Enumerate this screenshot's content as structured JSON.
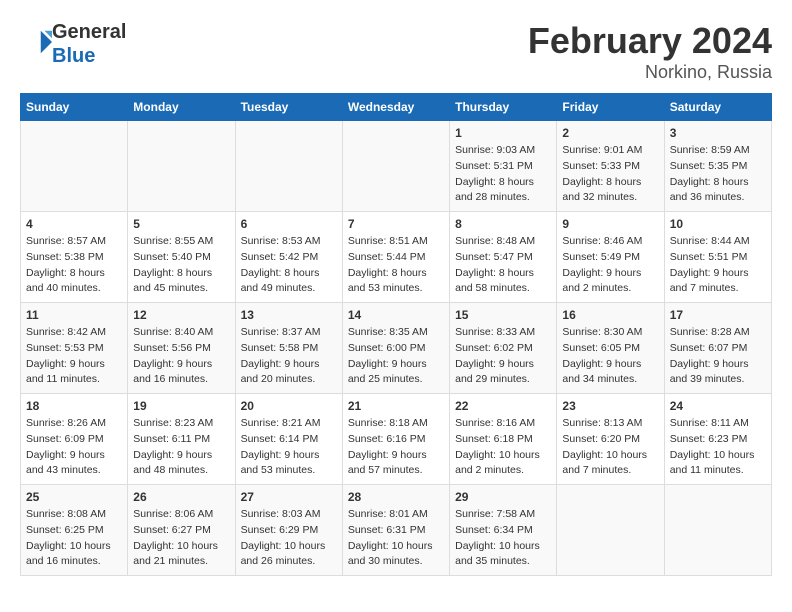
{
  "header": {
    "logo_line1": "General",
    "logo_line2": "Blue",
    "title": "February 2024",
    "subtitle": "Norkino, Russia"
  },
  "weekdays": [
    "Sunday",
    "Monday",
    "Tuesday",
    "Wednesday",
    "Thursday",
    "Friday",
    "Saturday"
  ],
  "weeks": [
    [
      {
        "day": "",
        "info": ""
      },
      {
        "day": "",
        "info": ""
      },
      {
        "day": "",
        "info": ""
      },
      {
        "day": "",
        "info": ""
      },
      {
        "day": "1",
        "info": "Sunrise: 9:03 AM\nSunset: 5:31 PM\nDaylight: 8 hours\nand 28 minutes."
      },
      {
        "day": "2",
        "info": "Sunrise: 9:01 AM\nSunset: 5:33 PM\nDaylight: 8 hours\nand 32 minutes."
      },
      {
        "day": "3",
        "info": "Sunrise: 8:59 AM\nSunset: 5:35 PM\nDaylight: 8 hours\nand 36 minutes."
      }
    ],
    [
      {
        "day": "4",
        "info": "Sunrise: 8:57 AM\nSunset: 5:38 PM\nDaylight: 8 hours\nand 40 minutes."
      },
      {
        "day": "5",
        "info": "Sunrise: 8:55 AM\nSunset: 5:40 PM\nDaylight: 8 hours\nand 45 minutes."
      },
      {
        "day": "6",
        "info": "Sunrise: 8:53 AM\nSunset: 5:42 PM\nDaylight: 8 hours\nand 49 minutes."
      },
      {
        "day": "7",
        "info": "Sunrise: 8:51 AM\nSunset: 5:44 PM\nDaylight: 8 hours\nand 53 minutes."
      },
      {
        "day": "8",
        "info": "Sunrise: 8:48 AM\nSunset: 5:47 PM\nDaylight: 8 hours\nand 58 minutes."
      },
      {
        "day": "9",
        "info": "Sunrise: 8:46 AM\nSunset: 5:49 PM\nDaylight: 9 hours\nand 2 minutes."
      },
      {
        "day": "10",
        "info": "Sunrise: 8:44 AM\nSunset: 5:51 PM\nDaylight: 9 hours\nand 7 minutes."
      }
    ],
    [
      {
        "day": "11",
        "info": "Sunrise: 8:42 AM\nSunset: 5:53 PM\nDaylight: 9 hours\nand 11 minutes."
      },
      {
        "day": "12",
        "info": "Sunrise: 8:40 AM\nSunset: 5:56 PM\nDaylight: 9 hours\nand 16 minutes."
      },
      {
        "day": "13",
        "info": "Sunrise: 8:37 AM\nSunset: 5:58 PM\nDaylight: 9 hours\nand 20 minutes."
      },
      {
        "day": "14",
        "info": "Sunrise: 8:35 AM\nSunset: 6:00 PM\nDaylight: 9 hours\nand 25 minutes."
      },
      {
        "day": "15",
        "info": "Sunrise: 8:33 AM\nSunset: 6:02 PM\nDaylight: 9 hours\nand 29 minutes."
      },
      {
        "day": "16",
        "info": "Sunrise: 8:30 AM\nSunset: 6:05 PM\nDaylight: 9 hours\nand 34 minutes."
      },
      {
        "day": "17",
        "info": "Sunrise: 8:28 AM\nSunset: 6:07 PM\nDaylight: 9 hours\nand 39 minutes."
      }
    ],
    [
      {
        "day": "18",
        "info": "Sunrise: 8:26 AM\nSunset: 6:09 PM\nDaylight: 9 hours\nand 43 minutes."
      },
      {
        "day": "19",
        "info": "Sunrise: 8:23 AM\nSunset: 6:11 PM\nDaylight: 9 hours\nand 48 minutes."
      },
      {
        "day": "20",
        "info": "Sunrise: 8:21 AM\nSunset: 6:14 PM\nDaylight: 9 hours\nand 53 minutes."
      },
      {
        "day": "21",
        "info": "Sunrise: 8:18 AM\nSunset: 6:16 PM\nDaylight: 9 hours\nand 57 minutes."
      },
      {
        "day": "22",
        "info": "Sunrise: 8:16 AM\nSunset: 6:18 PM\nDaylight: 10 hours\nand 2 minutes."
      },
      {
        "day": "23",
        "info": "Sunrise: 8:13 AM\nSunset: 6:20 PM\nDaylight: 10 hours\nand 7 minutes."
      },
      {
        "day": "24",
        "info": "Sunrise: 8:11 AM\nSunset: 6:23 PM\nDaylight: 10 hours\nand 11 minutes."
      }
    ],
    [
      {
        "day": "25",
        "info": "Sunrise: 8:08 AM\nSunset: 6:25 PM\nDaylight: 10 hours\nand 16 minutes."
      },
      {
        "day": "26",
        "info": "Sunrise: 8:06 AM\nSunset: 6:27 PM\nDaylight: 10 hours\nand 21 minutes."
      },
      {
        "day": "27",
        "info": "Sunrise: 8:03 AM\nSunset: 6:29 PM\nDaylight: 10 hours\nand 26 minutes."
      },
      {
        "day": "28",
        "info": "Sunrise: 8:01 AM\nSunset: 6:31 PM\nDaylight: 10 hours\nand 30 minutes."
      },
      {
        "day": "29",
        "info": "Sunrise: 7:58 AM\nSunset: 6:34 PM\nDaylight: 10 hours\nand 35 minutes."
      },
      {
        "day": "",
        "info": ""
      },
      {
        "day": "",
        "info": ""
      }
    ]
  ]
}
